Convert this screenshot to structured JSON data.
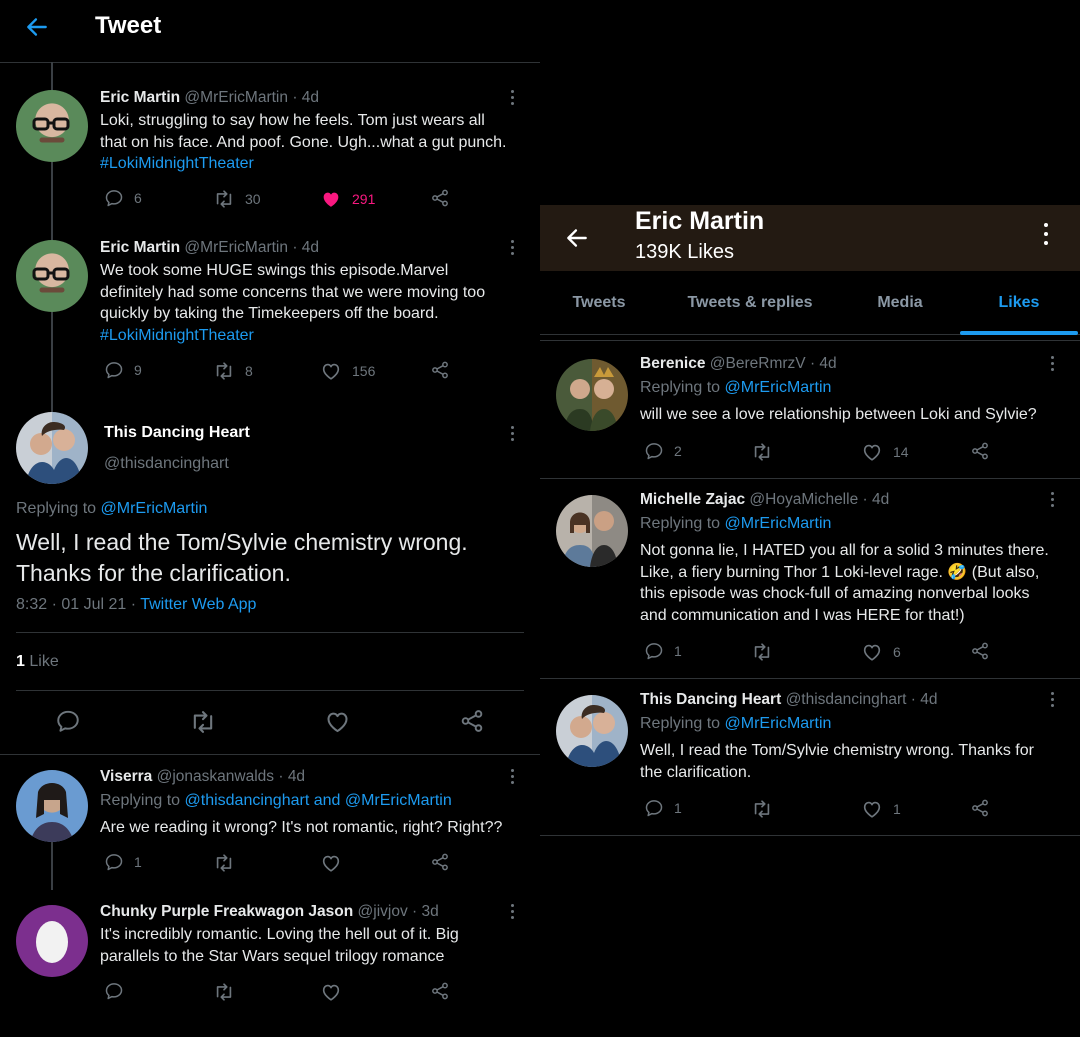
{
  "left": {
    "header_title": "Tweet",
    "thread": [
      {
        "name": "Eric Martin",
        "handle": "@MrEricMartin",
        "time": "4d",
        "text_lines": [
          "Loki, struggling to say how he feels. Tom just wears all",
          "that on his face. And poof. Gone. Ugh...what a gut punch."
        ],
        "hashtag": "#LokiMidnightTheater",
        "replies": "6",
        "retweets": "30",
        "likes": "291",
        "liked": true
      },
      {
        "name": "Eric Martin",
        "handle": "@MrEricMartin",
        "time": "4d",
        "text_lines": [
          "We took some HUGE swings this episode.Marvel",
          "definitely had some concerns that we were moving too",
          "quickly by taking the Timekeepers off the board."
        ],
        "hashtag": "#LokiMidnightTheater",
        "replies": "9",
        "retweets": "8",
        "likes": "156",
        "liked": false
      }
    ],
    "main": {
      "name": "This Dancing Heart",
      "handle": "@thisdancinghart",
      "replying_prefix": "Replying to",
      "replying_to": "@MrEricMartin",
      "text_lines": [
        "Well, I read the Tom/Sylvie chemistry wrong.",
        "Thanks for the clarification."
      ],
      "timestamp": "8:32 · 01 Jul 21 ·",
      "source": "Twitter Web App",
      "likes_count": "1",
      "likes_label": "Like"
    },
    "replies": [
      {
        "name": "Viserra",
        "handle": "@jonaskanwalds",
        "time": "4d",
        "replying_prefix": "Replying to",
        "replying_to": "@thisdancinghart and @MrEricMartin",
        "text": "Are we reading it wrong? It's not romantic, right? Right??",
        "replies": "1"
      },
      {
        "name": "Chunky Purple Freakwagon Jason",
        "handle": "@jivjov",
        "time": "3d",
        "text_lines": [
          "It's incredibly romantic. Loving the hell out of it. Big",
          "parallels to the Star Wars sequel trilogy romance"
        ]
      }
    ]
  },
  "right": {
    "header_name": "Eric Martin",
    "header_sub": "139K Likes",
    "tabs": [
      "Tweets",
      "Tweets & replies",
      "Media",
      "Likes"
    ],
    "active_tab": "Likes",
    "tweets": [
      {
        "name": "Berenice",
        "handle": "@BereRmrzV",
        "time": "4d",
        "replying_prefix": "Replying to",
        "replying_to": "@MrEricMartin",
        "text_lines": [
          "will we see a love relationship between Loki and Sylvie?"
        ],
        "replies": "2",
        "likes": "14"
      },
      {
        "name": "Michelle Zajac",
        "handle": "@HoyaMichelle",
        "time": "4d",
        "replying_prefix": "Replying to",
        "replying_to": "@MrEricMartin",
        "text_lines": [
          "Not gonna lie, I HATED you all for a solid 3 minutes there.",
          "Like, a fiery burning Thor 1 Loki-level rage. 🤣 (But also,",
          "this episode was chock-full of amazing nonverbal looks",
          "and communication and I was HERE for that!)"
        ],
        "replies": "1",
        "likes": "6"
      },
      {
        "name": "This Dancing Heart",
        "handle": "@thisdancinghart",
        "time": "4d",
        "replying_prefix": "Replying to",
        "replying_to": "@MrEricMartin",
        "text_lines": [
          "Well, I read the Tom/Sylvie chemistry wrong. Thanks for",
          "the clarification."
        ],
        "replies": "1",
        "likes": "1"
      }
    ]
  },
  "colors": {
    "background": "#000000",
    "accent_blue": "#1d9bf0",
    "like_pink": "#f91880",
    "muted": "#6e767d",
    "profile_header_bg": "#231a12",
    "divider": "#2f3336"
  }
}
